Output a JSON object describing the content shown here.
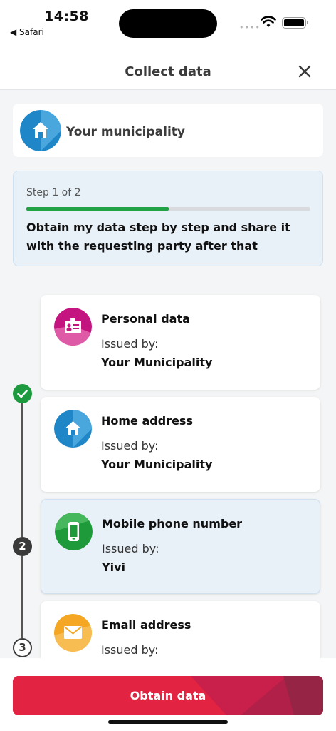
{
  "status_bar": {
    "time": "14:58",
    "back_app": "◀ Safari",
    "signal": "••••"
  },
  "header": {
    "title": "Collect data",
    "close_icon": "close-icon"
  },
  "municipality": {
    "label": "Your municipality",
    "icon": "house-icon"
  },
  "step": {
    "label": "Step 1 of 2",
    "progress": 0.5,
    "description": "Obtain my data step by step and share it with the requesting party after that"
  },
  "timeline": {
    "step2": "2",
    "step3": "3"
  },
  "cards": [
    {
      "title": "Personal data",
      "issued_label": "Issued by:",
      "issuer": "Your Municipality",
      "icon": "id-badge-icon",
      "color": "#c4147f"
    },
    {
      "title": "Home address",
      "issued_label": "Issued by:",
      "issuer": "Your Municipality",
      "icon": "house-icon",
      "color": "#1f86c8"
    },
    {
      "title": "Mobile phone number",
      "issued_label": "Issued by:",
      "issuer": "Yivi",
      "icon": "phone-icon",
      "color": "#1f9a3a"
    },
    {
      "title": "Email address",
      "issued_label": "Issued by:",
      "issuer": "",
      "icon": "envelope-icon",
      "color": "#f5a623"
    }
  ],
  "button": {
    "label": "Obtain data"
  },
  "colors": {
    "accent_red": "#e22342",
    "progress_green": "#21a245",
    "step_box_bg": "#e8f0f8"
  }
}
